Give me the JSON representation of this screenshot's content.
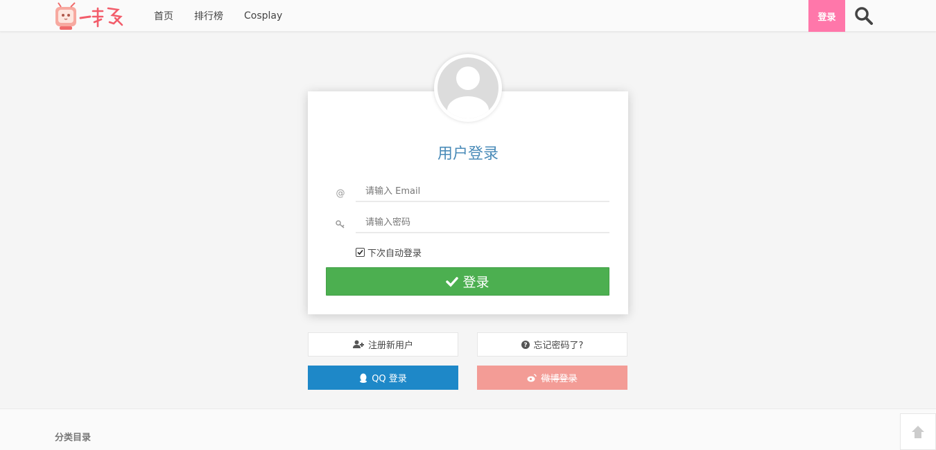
{
  "header": {
    "logo_text": "一抹多",
    "nav": [
      "首页",
      "排行榜",
      "Cosplay"
    ],
    "login_label": "登录",
    "accent": "#ff77aa"
  },
  "card": {
    "title": "用户登录",
    "email_icon": "@",
    "email_placeholder": "请输入 Email",
    "email_value": "",
    "password_icon": "key-icon",
    "password_placeholder": "请输入密码",
    "password_value": "",
    "remember_label": "下次自动登录",
    "remember_checked": true,
    "submit_label": "登录",
    "submit_color": "#4caf50"
  },
  "actions": {
    "register_label": "注册新用户",
    "forgot_label": "忘记密码了?",
    "qq_label": "QQ 登录",
    "qq_color": "#1e88c8",
    "weibo_label": "微博登录",
    "weibo_color": "#f39c96"
  },
  "footer": {
    "category_title": "分类目录"
  }
}
